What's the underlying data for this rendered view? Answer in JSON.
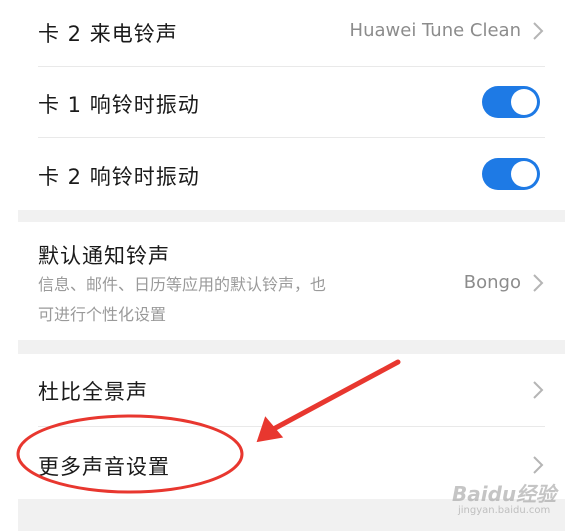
{
  "settings": {
    "card2_ringtone": {
      "label": "卡 2 来电铃声",
      "value": "Huawei Tune Clean"
    },
    "card1_vibrate": {
      "label": "卡 1 响铃时振动",
      "enabled": true
    },
    "card2_vibrate": {
      "label": "卡 2 响铃时振动",
      "enabled": true
    },
    "default_notification": {
      "label": "默认通知铃声",
      "description_line1": "信息、邮件、日历等应用的默认铃声，也",
      "description_line2": "可进行个性化设置",
      "value": "Bongo"
    },
    "dolby": {
      "label": "杜比全景声"
    },
    "more_sound": {
      "label": "更多声音设置"
    }
  },
  "annotation": {
    "color": "#e8372f"
  },
  "watermark": {
    "brand": "Baidu经验",
    "url": "jingyan.baidu.com"
  },
  "icons": {
    "chevron": "chevron-right-icon",
    "toggle": "toggle-switch"
  }
}
